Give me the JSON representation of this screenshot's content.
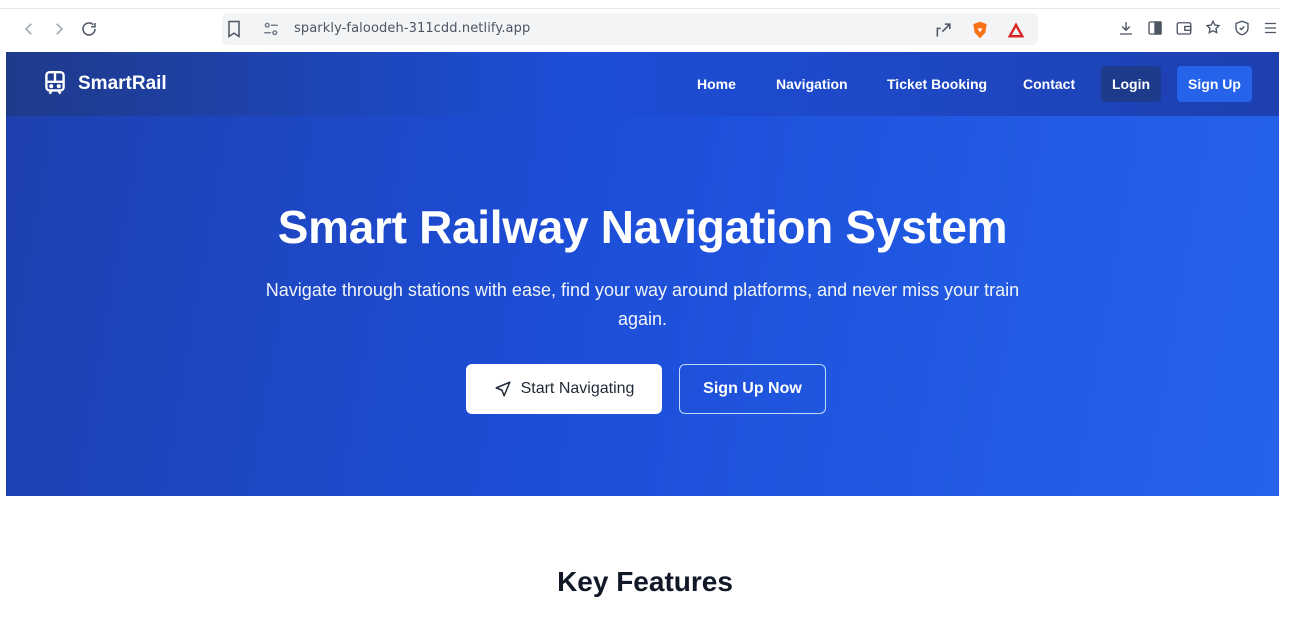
{
  "browser": {
    "url": "sparkly-faloodeh-311cdd.netlify.app"
  },
  "header": {
    "brand": "SmartRail",
    "nav": [
      "Home",
      "Navigation",
      "Ticket Booking",
      "Contact"
    ],
    "login_label": "Login",
    "signup_label": "Sign Up"
  },
  "hero": {
    "title": "Smart Railway Navigation System",
    "subtitle": "Navigate through stations with ease, find your way around platforms, and never miss your train again.",
    "primary_cta": "Start Navigating",
    "secondary_cta": "Sign Up Now"
  },
  "features": {
    "title": "Key Features"
  },
  "icons": {
    "brand": "train-icon",
    "primary_cta": "navigation-arrow-icon"
  },
  "colors": {
    "header_bg": "#1e3a8a",
    "hero_bg": "#1d4ed8",
    "accent": "#2563eb",
    "brave_orange": "#f97316",
    "warning_red": "#dc2626"
  }
}
